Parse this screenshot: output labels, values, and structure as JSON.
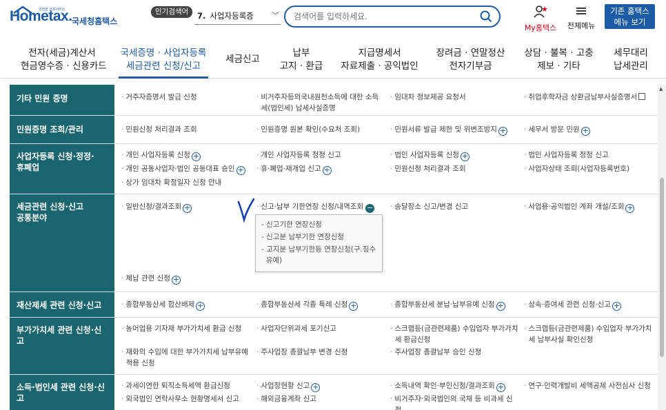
{
  "brand": {
    "logo_text_home": "Home",
    "logo_text_tax": "tax.",
    "logo_small": "안전한 납세서비스",
    "agency_name": "국세청홈택스",
    "color_primary": "#1c5ba6",
    "color_teal": "#1a6670"
  },
  "top": {
    "popular_badge": "인기검색어",
    "popular_num": "7.",
    "popular_term": "사업자등록증",
    "search_placeholder": "검색어를 입력하세요.",
    "my_hometax": "My홈택스",
    "all_menu": "전체메뉴",
    "legacy_btn_line1": "기존 홈택스",
    "legacy_btn_line2": "메뉴 보기"
  },
  "mainnav": [
    {
      "line1": "전자(세금)계산서",
      "line2": "현금영수증 · 신용카드"
    },
    {
      "line1": "국세증명 · 사업자등록",
      "line2": "세금관련 신청/신고",
      "active": true
    },
    {
      "line1": "세금신고",
      "line2": ""
    },
    {
      "line1": "납부",
      "line2": "고지 · 환급"
    },
    {
      "line1": "지급명세서",
      "line2": "자료제출 · 공익법인"
    },
    {
      "line1": "장려금 · 연말정산",
      "line2": "전자기부금"
    },
    {
      "line1": "상담 · 불복 · 고충",
      "line2": "제보 · 기타"
    },
    {
      "line1": "세무대리",
      "line2": "납세관리"
    }
  ],
  "rows": {
    "r0": {
      "title": "기타 민원 증명",
      "c0": "거주자증명서 발급 신청",
      "c1a": "비거주자등의국내원천소득에 대한 소득",
      "c1b": "세(법인세) 납세사실증명",
      "c2": "임대차 정보제공 요청서",
      "c3": "취업후학자금 상환금납부사실증명서"
    },
    "r1": {
      "title": "민원증명 조회/관리",
      "c0": "민원신청 처리결과 조회",
      "c1": "민원증명 원본 확인(수요처 조회)",
      "c2": "민원서류 발급 제한 및 위변조방지",
      "c3": "세무서 방문 민원"
    },
    "r2": {
      "title_a": "사업자등록 신청·정정·",
      "title_b": "휴폐업",
      "c0": "개인 사업자등록 신청",
      "c1": "개인 사업자등록 정정 신고",
      "c2": "법인 사업자등록 신청",
      "c3": "법인 사업자등록 정정 신고",
      "c4": "개인 공동사업자·법인 공동대표 승인",
      "c5": "휴·폐업·재개업 신고",
      "c6": "민원신청 처리결과 조회",
      "c7": "사업자상태 조회(사업자등록번호)",
      "c8": "상가 임대차 확정일자 신청 안내"
    },
    "r3": {
      "title_a": "세금관련 신청·신고",
      "title_b": "공통분야",
      "c0": "일반신청/결과조회",
      "c1": "신고·납부 기한연장 신청/내역조회",
      "c2": "송달장소 신고/변경 신고",
      "c3": "사업용·공익법인 계좌 개설/조회",
      "d0": "신고기한 연장신청",
      "d1": "신고분 납부기한 연장신청",
      "d2a": "고지분 납부기한등 연장신청(구.징수",
      "d2b": "유예)",
      "c4": "체납 관련 신청"
    },
    "r4": {
      "title": "재산제세 관련 신청·신고",
      "c0": "종합부동산세 합산배제",
      "c1": "종합부동산세 각종 특례 신청",
      "c2": "종합부동산세 분납·납부유예 신청",
      "c3": "상속·증여세 관련 신청·신고"
    },
    "r5": {
      "title": "부가가치세 관련 신청·신고",
      "c0": "농어업용 기자재 부가가치세 환급 신청",
      "c1": "사업자단위과세 포기신고",
      "c2a": "스크랩등(금관련제품) 수입업자 부가가치",
      "c2b": "세 환급신청",
      "c3a": "스크랩등(금관련제품) 수입업자 부가가치",
      "c3b": "세 납부사실 확인신청",
      "c4a": "재화의 수입에 대한 부가가치세 납부유예",
      "c4b": "적용 신청",
      "c5": "주사업장 총괄납부 변경 신청",
      "c6": "주사업장 총괄납부 승인 신청"
    },
    "r6": {
      "title": "소득·법인세 관련 신청·신고",
      "c0": "과세이연한 퇴직소득세액 환급신청",
      "c1": "사업장현황 신고",
      "c2": "소득내역 확인·부인신청/결과조회",
      "c3": "연구·인력개발비 세액공제 사전심사 신청",
      "c4": "외국법인 연락사무소 현황명세서 신고",
      "c5": "해외금융계좌 신고",
      "c6a": "비거주자·외국법인의 국채 등 비과세 신",
      "c6b": "청"
    }
  }
}
